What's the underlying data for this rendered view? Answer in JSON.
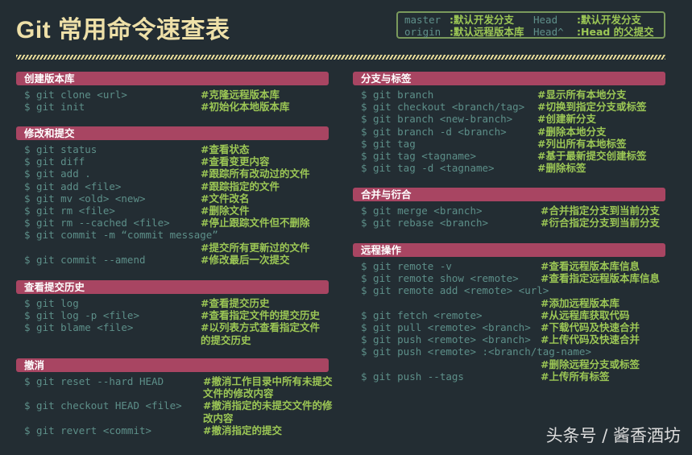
{
  "title": "Git 常用命令速查表",
  "legend": [
    {
      "key": "master",
      "value": ":默认开发分支",
      "key2": "Head",
      "value2": ":默认开发分支"
    },
    {
      "key": "origin",
      "value": ":默认远程版本库",
      "key2": "Head^",
      "value2": ":Head 的父提交"
    }
  ],
  "sections": {
    "create": {
      "title": "创建版本库",
      "rows": [
        {
          "cmd": "$ git clone <url>",
          "desc": "#克隆远程版本库"
        },
        {
          "cmd": "$ git init",
          "desc": "#初始化本地版本库"
        }
      ]
    },
    "modify": {
      "title": "修改和提交",
      "rows": [
        {
          "cmd": "$ git status",
          "desc": "#查看状态"
        },
        {
          "cmd": "$ git diff",
          "desc": "#查看变更内容"
        },
        {
          "cmd": "$ git add .",
          "desc": "#跟踪所有改动过的文件"
        },
        {
          "cmd": "$ git add <file>",
          "desc": "#跟踪指定的文件"
        },
        {
          "cmd": "$ git mv <old> <new>",
          "desc": "#文件改名"
        },
        {
          "cmd": "$ git rm <file>",
          "desc": "#删除文件"
        },
        {
          "cmd": "$ git rm --cached <file>",
          "desc": "#停止跟踪文件但不删除"
        },
        {
          "cmd": "$ git commit -m “commit message”",
          "desc": ""
        },
        {
          "cmd": "",
          "desc": "#提交所有更新过的文件"
        },
        {
          "cmd": "$ git commit --amend",
          "desc": "#修改最后一次提交"
        }
      ]
    },
    "history": {
      "title": "查看提交历史",
      "rows": [
        {
          "cmd": "$ git log",
          "desc": "#查看提交历史"
        },
        {
          "cmd": "$ git log -p <file>",
          "desc": "#查看指定文件的提交历史"
        },
        {
          "cmd": "$ git blame <file>",
          "desc": "#以列表方式查看指定文件"
        },
        {
          "cmd": "",
          "desc": "的提交历史"
        }
      ]
    },
    "undo": {
      "title": "撤消",
      "rows": [
        {
          "cmd": "$ git reset --hard HEAD",
          "desc": "#撤消工作目录中所有未提交"
        },
        {
          "cmd": "",
          "desc": "文件的修改内容"
        },
        {
          "cmd": "$ git checkout HEAD <file>",
          "desc": "#撤消指定的未提交文件的修"
        },
        {
          "cmd": "",
          "desc": "改内容"
        },
        {
          "cmd": "$ git revert <commit>",
          "desc": "#撤消指定的提交"
        }
      ]
    },
    "branch": {
      "title": "分支与标签",
      "rows": [
        {
          "cmd": "$ git branch",
          "desc": "#显示所有本地分支"
        },
        {
          "cmd": "$ git checkout <branch/tag>",
          "desc": "#切换到指定分支或标签"
        },
        {
          "cmd": "$ git branch <new-branch>",
          "desc": "#创建新分支"
        },
        {
          "cmd": "$ git branch -d <branch>",
          "desc": "#删除本地分支"
        },
        {
          "cmd": "$ git tag",
          "desc": "#列出所有本地标签"
        },
        {
          "cmd": "$ git tag <tagname>",
          "desc": "#基于最新提交创建标签"
        },
        {
          "cmd": "$ git tag -d <tagname>",
          "desc": "#删除标签"
        }
      ]
    },
    "merge": {
      "title": "合并与衍合",
      "rows": [
        {
          "cmd": "$ git merge <branch>",
          "desc": "#合并指定分支到当前分支"
        },
        {
          "cmd": "$ git rebase <branch>",
          "desc": "#衍合指定分支到当前分支"
        }
      ]
    },
    "remote": {
      "title": "远程操作",
      "rows": [
        {
          "cmd": "$ git remote -v",
          "desc": "#查看远程版本库信息"
        },
        {
          "cmd": "$ git remote show <remote>",
          "desc": "#查看指定远程版本库信息"
        },
        {
          "cmd": "$ git remote add <remote> <url>",
          "desc": ""
        },
        {
          "cmd": "",
          "desc": "#添加远程版本库"
        },
        {
          "cmd": "$ git fetch <remote>",
          "desc": "#从远程库获取代码"
        },
        {
          "cmd": "$ git pull <remote> <branch>",
          "desc": "#下载代码及快速合并"
        },
        {
          "cmd": "$ git push <remote> <branch>",
          "desc": "#上传代码及快速合并"
        },
        {
          "cmd": "$ git push <remote> :<branch/tag-name>",
          "desc": ""
        },
        {
          "cmd": "",
          "desc": "#删除远程分支或标签"
        },
        {
          "cmd": "$ git push --tags",
          "desc": "#上传所有标签"
        }
      ]
    }
  },
  "watermark": "头条号 / 酱香酒坊"
}
